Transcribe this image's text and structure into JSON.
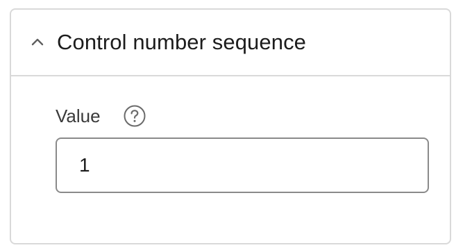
{
  "panel": {
    "title": "Control number sequence",
    "expanded": true,
    "chevron_icon": "chevron-up-icon"
  },
  "field": {
    "label": "Value",
    "help_icon": "question-circle-icon",
    "value": "1"
  },
  "colors": {
    "border": "#d9d9d9",
    "input_border": "#8a8a8a",
    "text": "#1c1c1c",
    "icon": "#5f5f5f"
  }
}
